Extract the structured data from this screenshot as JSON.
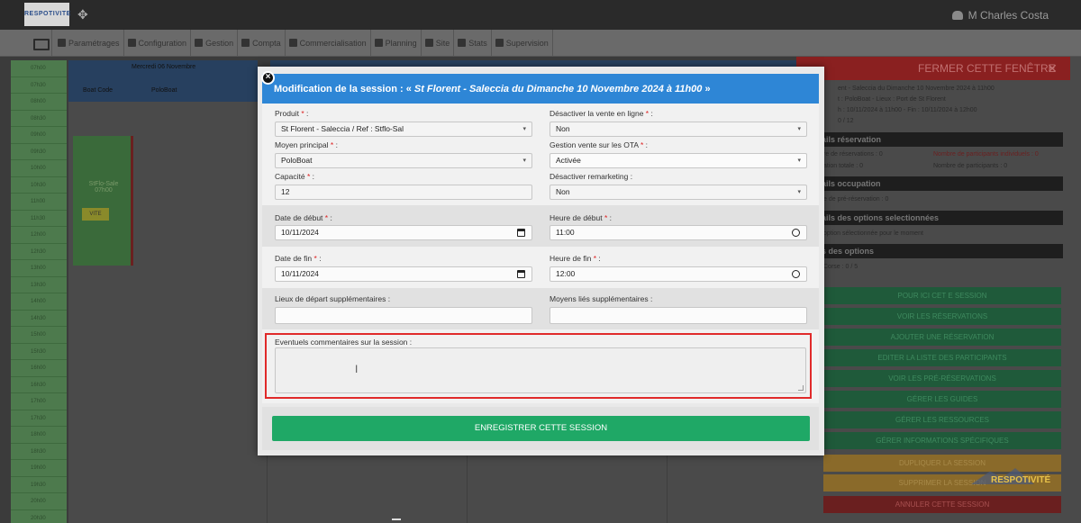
{
  "app": {
    "logo_text": "RESPOTIVITE",
    "user_name": "M Charles Costa"
  },
  "nav": {
    "items": [
      "Paramétrages",
      "Configuration",
      "Gestion",
      "Compta",
      "Commercialisation",
      "Planning",
      "Site",
      "Stats",
      "Supervision"
    ]
  },
  "calendar": {
    "times": [
      "07h00",
      "07h30",
      "08h00",
      "08h30",
      "09h00",
      "09h30",
      "10h00",
      "10h30",
      "11h00",
      "11h30",
      "12h00",
      "12h30",
      "13h00",
      "13h30",
      "14h00",
      "14h30",
      "15h00",
      "15h30",
      "16h00",
      "16h30",
      "17h00",
      "17h30",
      "18h00",
      "18h30",
      "19h00",
      "19h30",
      "20h00",
      "20h30"
    ],
    "day_header": "Mercredi 06 Novembre",
    "col1": "Boat Code",
    "col2": "PoloBoat",
    "col3": "SpeedBoat",
    "event_text": "StFlo-Sale 07h00",
    "event_btn": "VITE"
  },
  "right_panel": {
    "close_label": "FERMER CETTE FENÊTRE",
    "close_x": "✕",
    "line1": "ent - Saleccia du Dimanche 10 Novembre 2024 à 11h00",
    "line2": "t : PoloBoat - Lieux : Port de St Florent",
    "line3": "h : 10/11/2024 à 11h00 - Fin : 10/11/2024 à 12h00",
    "line4": "0 / 12",
    "sections": [
      "ails réservation",
      "ails occupation",
      "ails des options selectionnées",
      "s des options"
    ],
    "s1a": "re de réservations : 0",
    "s1b": "Nombre de participants individuels : 0",
    "s1c": "ation totale : 0",
    "s1d": "Nombre de participants : 0",
    "s2a": "e de pré-réservation : 0",
    "s3a": "option sélectionnée pour le moment",
    "s4a": "Corse : 0 / 5",
    "buttons": [
      "POUR ICI CET E SESSION",
      "VOIR LES RÉSERVATIONS",
      "AJOUTER UNE RÉSERVATION",
      "EDITER LA LISTE DES PARTICIPANTS",
      "VOIR LES PRÉ-RÉSERVATIONS",
      "GÉRER LES GUIDES",
      "GÉRER LES RESSOURCES",
      "GÉRER INFORMATIONS SPÉCIFIQUES"
    ],
    "orange_buttons": [
      "DUPLIQUER LA SESSION",
      "SUPPRIMER LA SESSION"
    ],
    "cancel_label": "ANNULER CETTE SESSION",
    "watermark": "RESPOTIVITÉ"
  },
  "modal": {
    "title_prefix": "Modification de la session : «",
    "title_session": "St Florent - Saleccia du Dimanche 10 Novembre 2024 à 11h00",
    "title_suffix": "»",
    "close_symbol": "×",
    "produit_label": "Produit",
    "produit_value": "St Florent - Saleccia / Ref : Stflo-Sal",
    "desactiver_vente_label": "Désactiver la vente en ligne",
    "desactiver_vente_value": "Non",
    "moyen_label": "Moyen principal",
    "moyen_value": "PoloBoat",
    "gestion_ota_label": "Gestion vente sur les OTA",
    "gestion_ota_value": "Activée",
    "capacite_label": "Capacité",
    "capacite_value": "12",
    "remarketing_label": "Désactiver remarketing :",
    "remarketing_value": "Non",
    "date_debut_label": "Date de début",
    "date_debut_value": "10/11/2024",
    "heure_debut_label": "Heure de début",
    "heure_debut_value": "11:00",
    "date_fin_label": "Date de fin",
    "date_fin_value": "10/11/2024",
    "heure_fin_label": "Heure de fin",
    "heure_fin_value": "12:00",
    "lieux_label": "Lieux de départ supplémentaires :",
    "lieux_value": "",
    "moyens_label": "Moyens liés supplémentaires :",
    "moyens_value": "",
    "commentaires_label": "Eventuels commentaires sur la session :",
    "commentaires_value": "",
    "save_label": "ENREGISTRER CETTE SESSION",
    "required_mark": "*",
    "colon": ":",
    "caret": "▾"
  }
}
